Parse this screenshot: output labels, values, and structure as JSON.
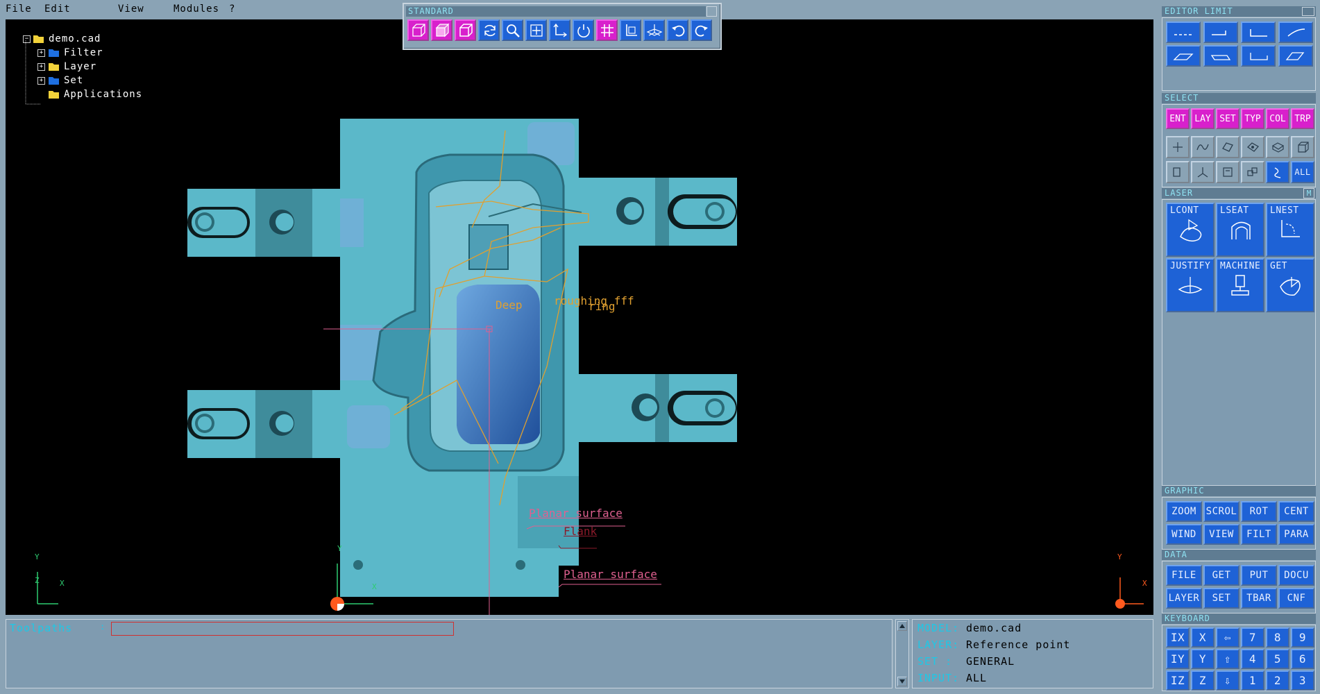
{
  "menu": [
    "File",
    "Edit",
    "View",
    "Modules",
    "?"
  ],
  "standard_toolbar": {
    "title": "STANDARD",
    "buttons": [
      {
        "icon": "wireframe-cube-icon",
        "style": "magenta"
      },
      {
        "icon": "shaded-cube-icon",
        "style": "magenta"
      },
      {
        "icon": "solid-cube-icon",
        "style": "magenta"
      },
      {
        "icon": "regenerate-icon",
        "style": "blue"
      },
      {
        "icon": "zoom-icon",
        "style": "blue"
      },
      {
        "icon": "center-icon",
        "style": "blue"
      },
      {
        "icon": "axes-icon",
        "style": "blue"
      },
      {
        "icon": "rotate-icon",
        "style": "blue"
      },
      {
        "icon": "grid-icon",
        "style": "magenta"
      },
      {
        "icon": "frame-icon",
        "style": "blue"
      },
      {
        "icon": "workplane-icon",
        "style": "blue"
      },
      {
        "icon": "undo-icon",
        "style": "blue"
      },
      {
        "icon": "redo-icon",
        "style": "blue"
      }
    ]
  },
  "tree": {
    "root": "demo.cad",
    "items": [
      {
        "label": "Filter",
        "folder_color": "#1e6fe0"
      },
      {
        "label": "Layer",
        "folder_color": "#f2d23a"
      },
      {
        "label": "Set",
        "folder_color": "#1e6fe0"
      },
      {
        "label": "Applications",
        "folder_color": "#f2d23a"
      }
    ]
  },
  "annotations": {
    "deep": "Deep",
    "roughing": "roughing fff",
    "ring": "ring",
    "planar1": "Planar surface",
    "flank": "Flank",
    "planar2": "Planar surface"
  },
  "axes_small": {
    "y": "Y",
    "x": "X",
    "z": "Z"
  },
  "right_panel": {
    "editor_title": "EDITOR  LIMIT",
    "select_title": "SELECT",
    "select_tabs": [
      "ENT",
      "LAY",
      "SET",
      "TYP",
      "COL",
      "TRP"
    ],
    "select_all": "ALL",
    "laser_title": "LASER",
    "laser_m": "M",
    "laser_buttons": [
      "LCONT",
      "LSEAT",
      "LNEST",
      "JUSTIFY",
      "MACHINE",
      "GET"
    ],
    "graphic_title": "GRAPHIC",
    "graphic_buttons": [
      "ZOOM",
      "SCROL",
      "ROT",
      "CENT",
      "WIND",
      "VIEW",
      "FILT",
      "PARA"
    ],
    "data_title": "DATA",
    "data_buttons": [
      "FILE",
      "GET",
      "PUT",
      "DOCU",
      "LAYER",
      "SET",
      "TBAR",
      "CNF"
    ],
    "keyboard_title": "KEYBOARD",
    "keyboard_rows": [
      [
        "IX",
        "X",
        "⇦",
        "7",
        "8",
        "9"
      ],
      [
        "IY",
        "Y",
        "⇧",
        "4",
        "5",
        "6"
      ],
      [
        "IZ",
        "Z",
        "⇩",
        "1",
        "2",
        "3"
      ]
    ]
  },
  "toolpaths": {
    "label": "Toolpaths",
    "sep": ":",
    "value": ""
  },
  "info": {
    "model_k": "MODEL:",
    "model_v": "demo.cad",
    "layer_k": "LAYER:",
    "layer_v": "Reference point",
    "set_k": "SET  :",
    "set_v": "GENERAL",
    "input_k": "INPUT:",
    "input_v": "ALL"
  },
  "colors": {
    "panel": "#8aa3b5",
    "header": "#5f7c92",
    "header_text": "#8fe3f3",
    "blue_btn": "#1e62d6",
    "magenta_btn": "#d820cc",
    "part": "#5bb8c9"
  }
}
